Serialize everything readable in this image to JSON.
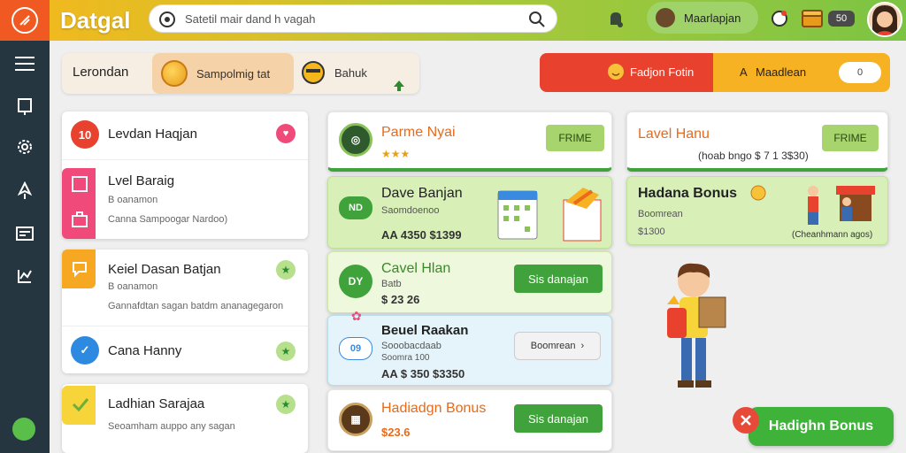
{
  "app": {
    "title": "Datgal"
  },
  "search": {
    "placeholder": "Satetil mair dand h vagah"
  },
  "header": {
    "mode_label": "Maarlapjan",
    "badge": "50"
  },
  "tabs": [
    {
      "label": "Lerondan"
    },
    {
      "label": "Sampolmig tat"
    },
    {
      "label": "Bahuk"
    }
  ],
  "banner": {
    "left_label": "Fadjon Fotin",
    "right_label": "Maadlean",
    "pill": "0"
  },
  "left_list": [
    {
      "icon_text": "10",
      "title": "Levdan Haqjan"
    },
    {
      "title": "Lvel Baraig",
      "sub1": "B oanamon",
      "sub2": "Canna Sampoogar Nardoo)"
    },
    {
      "title": "Keiel Dasan Batjan",
      "sub1": "B oanamon",
      "sub2": "Gannafdtan sagan batdm ananagegaron"
    },
    {
      "title": "Cana Hanny"
    },
    {
      "title": "Ladhian Sarajaa",
      "sub1": "Seoamham auppo any sagan"
    }
  ],
  "middle_cards": [
    {
      "title": "Parme Nyai",
      "stars": "★★★",
      "button": "FRIME"
    },
    {
      "badge": "ND",
      "title": "Dave Banjan",
      "sub": "Saomdoenoo",
      "value": "AA 4350 $1399"
    },
    {
      "badge": "DY",
      "title": "Cavel Hlan",
      "sub": "Batb",
      "value": "$ 23 26",
      "button": "Sis danajan"
    },
    {
      "badge": "09",
      "title": "Beuel Raakan",
      "sub1": "Sooobacdaab",
      "sub2": "Soomra 100",
      "value": "AA $ 350 $3350",
      "dropdown": "Boomrean"
    },
    {
      "title": "Hadiadgn Bonus",
      "value": "$23.6",
      "button": "Sis danajan"
    }
  ],
  "right_cards": [
    {
      "title": "Lavel Hanu",
      "sub": "(hoab bngo $ 7 1 3$30)",
      "button": "FRIME"
    },
    {
      "title": "Hadana Bonus",
      "sub1": "Boomrean",
      "sub2": "$1300",
      "caption": "(Cheanhmann agos)"
    }
  ],
  "bonus_button": {
    "label": "Hadighn Bonus"
  },
  "colors": {
    "accent_orange": "#f05a22",
    "accent_green": "#3fa23a",
    "sidebar_bg": "#263640",
    "banner_red": "#e8412e",
    "banner_yellow": "#f7b223"
  }
}
